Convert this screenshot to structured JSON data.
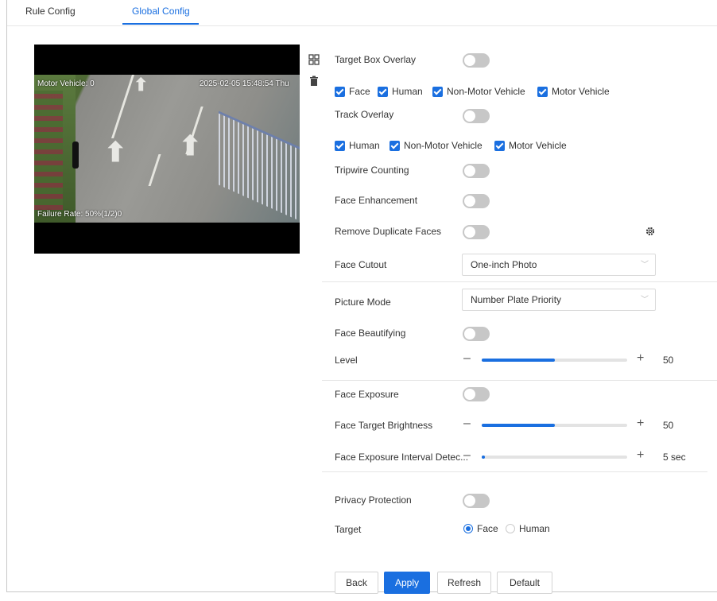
{
  "tabs": [
    {
      "label": "Rule Config",
      "active": false
    },
    {
      "label": "Global Config",
      "active": true
    }
  ],
  "video": {
    "osd_top_left": "Motor Vehicle: 0",
    "osd_timestamp": "2025-02-05 15:48:54 Thu",
    "osd_bottom_left": "Failure Rate: 50%(1/2)0"
  },
  "video_tools": [
    "fullscreen-grid-icon",
    "trash-icon"
  ],
  "settings": {
    "target_box_overlay": {
      "label": "Target Box Overlay",
      "enabled": false
    },
    "target_box_types": [
      {
        "label": "Face",
        "checked": true
      },
      {
        "label": "Human",
        "checked": true
      },
      {
        "label": "Non-Motor Vehicle",
        "checked": true
      },
      {
        "label": "Motor Vehicle",
        "checked": true
      }
    ],
    "track_overlay": {
      "label": "Track Overlay",
      "enabled": false
    },
    "track_types": [
      {
        "label": "Human",
        "checked": true
      },
      {
        "label": "Non-Motor Vehicle",
        "checked": true
      },
      {
        "label": "Motor Vehicle",
        "checked": true
      }
    ],
    "tripwire_counting": {
      "label": "Tripwire Counting",
      "enabled": false
    },
    "face_enhancement": {
      "label": "Face Enhancement",
      "enabled": false
    },
    "remove_duplicate_faces": {
      "label": "Remove Duplicate Faces",
      "enabled": false,
      "icon": "gear-icon"
    },
    "face_cutout": {
      "label": "Face Cutout",
      "value": "One-inch Photo"
    },
    "picture_mode": {
      "label": "Picture Mode",
      "value": "Number Plate Priority"
    },
    "face_beautifying": {
      "label": "Face Beautifying",
      "enabled": false
    },
    "level": {
      "label": "Level",
      "value": "50",
      "fraction": 0.5
    },
    "face_exposure": {
      "label": "Face Exposure",
      "enabled": false
    },
    "face_target_brightness": {
      "label": "Face Target Brightness",
      "value": "50",
      "fraction": 0.5
    },
    "face_exposure_interval": {
      "label": "Face Exposure Interval Detec...",
      "value": "5 sec",
      "fraction": 0.02
    },
    "privacy_protection": {
      "label": "Privacy Protection",
      "enabled": false
    },
    "target": {
      "label": "Target",
      "options": [
        {
          "label": "Face",
          "selected": true
        },
        {
          "label": "Human",
          "selected": false
        }
      ]
    }
  },
  "buttons": {
    "back": "Back",
    "apply": "Apply",
    "refresh": "Refresh",
    "default": "Default"
  },
  "colors": {
    "accent": "#1a6fe0",
    "toggle_off": "#c7c7c7"
  }
}
